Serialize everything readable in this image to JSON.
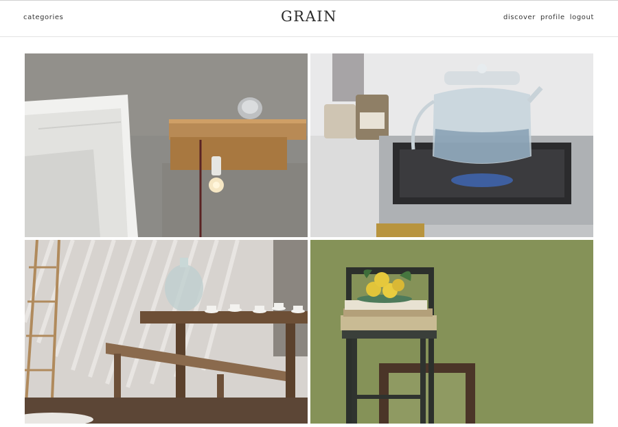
{
  "header": {
    "brand": "GRAIN",
    "left_link": "categories",
    "right_links": {
      "discover": "discover",
      "profile": "profile",
      "logout": "logout"
    }
  },
  "gallery": {
    "items": [
      {
        "name": "bedside-shelf-photo"
      },
      {
        "name": "glass-kettle-photo"
      },
      {
        "name": "rustic-dining-table-photo"
      },
      {
        "name": "chair-lemons-photo"
      }
    ]
  },
  "colors": {
    "header_border": "#e3e3e3",
    "text": "#333333",
    "background": "#ffffff"
  }
}
